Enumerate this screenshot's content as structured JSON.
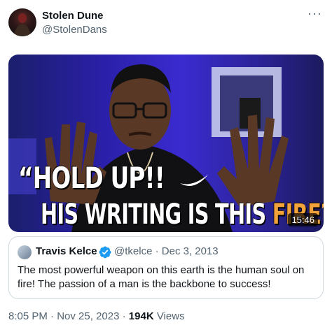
{
  "author": {
    "name": "Stolen Dune",
    "handle": "@StolenDans",
    "avatar_icon": "profile-avatar"
  },
  "more_icon": "ellipsis-icon",
  "media": {
    "caption_line1": "“HOLD UP!!",
    "caption_line2_prefix": "HIS WRITING IS THIS ",
    "caption_line2_highlight": "FIRE???”",
    "duration": "15:46",
    "highlight_color": "#f2a23a"
  },
  "quote": {
    "name": "Travis Kelce",
    "verified_icon": "verified-badge-icon",
    "handle": "@tkelce",
    "separator": "·",
    "date": "Dec 3, 2013",
    "text": "The most powerful weapon on this earth is the human soul on fire! The passion of a man is the backbone to success!"
  },
  "footer": {
    "time": "8:05 PM",
    "date": "Nov 25, 2023",
    "views_count": "194K",
    "views_label": "Views"
  },
  "colors": {
    "text": "#0f1419",
    "secondary": "#536471",
    "border": "#cfd9de",
    "verified": "#1d9bf0"
  }
}
